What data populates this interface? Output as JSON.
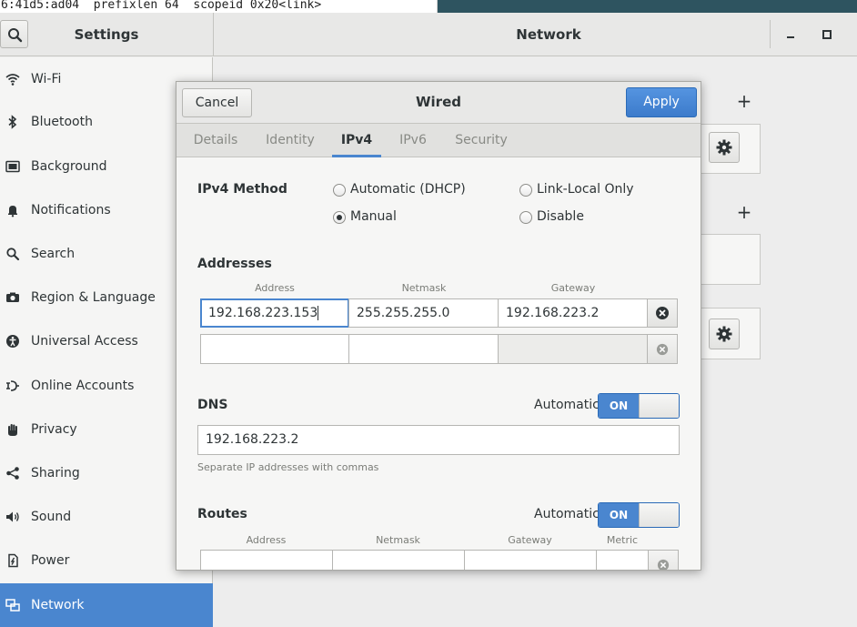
{
  "terminal": {
    "text": "6:41d5:ad04  prefixlen 64  scopeid 0x20<link>"
  },
  "header": {
    "left_title": "Settings",
    "right_title": "Network"
  },
  "window_controls": {
    "minimize": "minimize-icon",
    "maximize": "maximize-icon"
  },
  "sidebar": {
    "items": [
      {
        "label": "Wi-Fi",
        "icon": "wifi-icon"
      },
      {
        "label": "Bluetooth",
        "icon": "bluetooth-icon"
      },
      {
        "label": "Background",
        "icon": "background-icon"
      },
      {
        "label": "Notifications",
        "icon": "bell-icon"
      },
      {
        "label": "Search",
        "icon": "search-icon"
      },
      {
        "label": "Region & Language",
        "icon": "camera-icon"
      },
      {
        "label": "Universal Access",
        "icon": "accessibility-icon"
      },
      {
        "label": "Online Accounts",
        "icon": "online-accounts-icon"
      },
      {
        "label": "Privacy",
        "icon": "hand-icon"
      },
      {
        "label": "Sharing",
        "icon": "share-icon"
      },
      {
        "label": "Sound",
        "icon": "speaker-icon"
      },
      {
        "label": "Power",
        "icon": "power-icon"
      },
      {
        "label": "Network",
        "icon": "network-icon",
        "active": true
      }
    ]
  },
  "dialog": {
    "title": "Wired",
    "cancel_label": "Cancel",
    "apply_label": "Apply",
    "tabs": [
      {
        "label": "Details"
      },
      {
        "label": "Identity"
      },
      {
        "label": "IPv4",
        "active": true
      },
      {
        "label": "IPv6"
      },
      {
        "label": "Security"
      }
    ],
    "ipv4": {
      "method_label": "IPv4 Method",
      "methods": [
        {
          "label": "Automatic (DHCP)",
          "checked": false
        },
        {
          "label": "Link-Local Only",
          "checked": false
        },
        {
          "label": "Manual",
          "checked": true
        },
        {
          "label": "Disable",
          "checked": false
        }
      ],
      "addresses_label": "Addresses",
      "columns": {
        "address": "Address",
        "netmask": "Netmask",
        "gateway": "Gateway"
      },
      "rows": [
        {
          "address": "192.168.223.153",
          "netmask": "255.255.255.0",
          "gateway": "192.168.223.2"
        },
        {
          "address": "",
          "netmask": "",
          "gateway": ""
        }
      ],
      "dns": {
        "label": "DNS",
        "automatic_label": "Automatic",
        "switch_state": "ON",
        "value": "192.168.223.2",
        "hint": "Separate IP addresses with commas"
      },
      "routes": {
        "label": "Routes",
        "automatic_label": "Automatic",
        "switch_state": "ON",
        "columns": {
          "address": "Address",
          "netmask": "Netmask",
          "gateway": "Gateway",
          "metric": "Metric"
        }
      }
    }
  },
  "colors": {
    "accent": "#4a86cf",
    "sidebar_active": "#4a86cf",
    "apply": "#3c7bcb"
  }
}
